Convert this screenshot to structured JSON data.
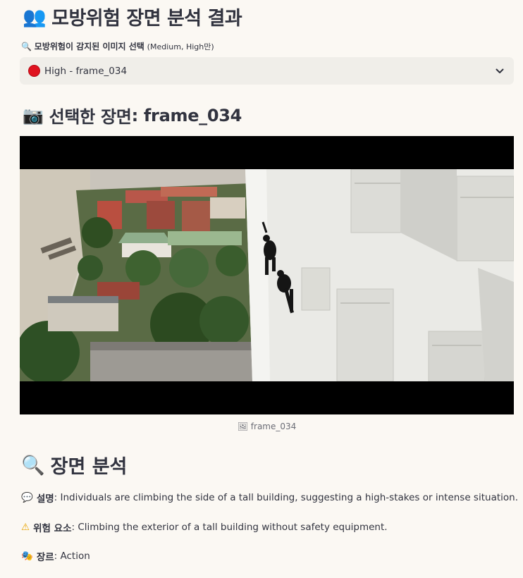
{
  "header": {
    "emoji": "👥",
    "title": "모방위험 장면 분석 결과"
  },
  "select": {
    "label_emoji": "🔍",
    "label_bold": "모방위험이 감지된 이미지 선택",
    "label_sub": "(Medium, High만)",
    "selected_value": "High - frame_034",
    "status_color": "#e0131f"
  },
  "selected_scene": {
    "emoji": "📷",
    "title_prefix": "선택한 장면",
    "title_value": ": frame_034",
    "caption_icon": "🖼",
    "caption": "frame_034"
  },
  "analysis": {
    "emoji": "🔍",
    "title": "장면 분석",
    "description": {
      "emoji": "💬",
      "label": "설명",
      "text": ": Individuals are climbing the side of a tall building, suggesting a high-stakes or intense situation."
    },
    "risk": {
      "emoji": "⚠",
      "label": "위험 요소",
      "text": ": Climbing the exterior of a tall building without safety equipment."
    },
    "genre": {
      "emoji": "🎭",
      "label": "장르",
      "text": ": Action"
    }
  }
}
